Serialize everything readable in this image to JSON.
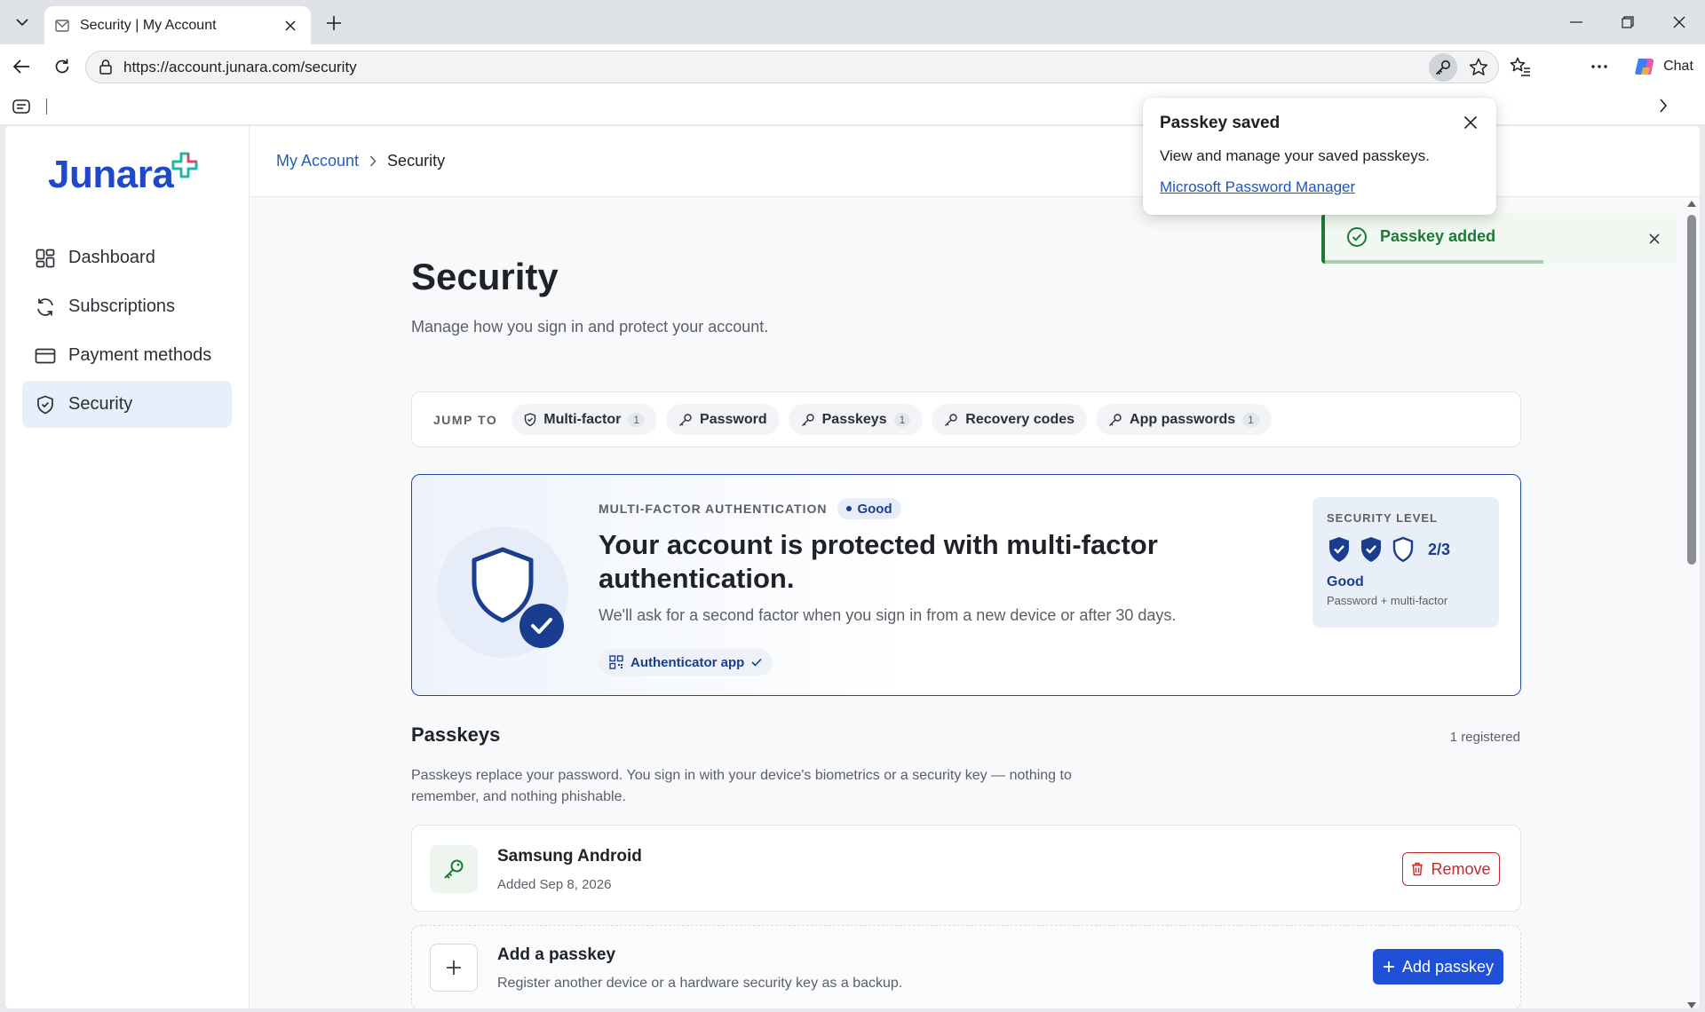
{
  "browser": {
    "tab_title": "Security | My Account",
    "url_host": "https://account.junara.com",
    "url_path": "/security",
    "chat_label": "Chat"
  },
  "popup": {
    "title": "Passkey saved",
    "description": "View and manage your saved passkeys.",
    "link": "Microsoft Password Manager"
  },
  "toast": {
    "message": "Passkey added",
    "progress": 0.62
  },
  "sidebar": {
    "logo": "Junara",
    "items": [
      {
        "label": "Dashboard",
        "icon": "dashboard-icon",
        "active": false
      },
      {
        "label": "Subscriptions",
        "icon": "refresh-icon",
        "active": false
      },
      {
        "label": "Payment methods",
        "icon": "card-icon",
        "active": false
      },
      {
        "label": "Security",
        "icon": "shield-icon",
        "active": true
      }
    ]
  },
  "breadcrumb": {
    "parent": "My Account",
    "current": "Security"
  },
  "page": {
    "title": "Security",
    "subtitle": "Manage how you sign in and protect your account."
  },
  "jump": {
    "label": "JUMP TO",
    "chips": [
      {
        "label": "Multi-factor",
        "count": "1",
        "icon": "shield-icon"
      },
      {
        "label": "Password",
        "count": "",
        "icon": "key-icon"
      },
      {
        "label": "Passkeys",
        "count": "1",
        "icon": "key-icon"
      },
      {
        "label": "Recovery codes",
        "count": "",
        "icon": "key-icon"
      },
      {
        "label": "App passwords",
        "count": "1",
        "icon": "key-icon"
      }
    ]
  },
  "mfa": {
    "eyebrow": "MULTI-FACTOR AUTHENTICATION",
    "status": "Good",
    "title": "Your account is protected with multi-factor authentication.",
    "description": "We'll ask for a second factor when you sign in from a new device or after 30 days.",
    "method": "Authenticator app",
    "level": {
      "label": "SECURITY LEVEL",
      "value": "2/3",
      "filled": 2,
      "total": 3,
      "rating": "Good",
      "detail": "Password + multi-factor"
    }
  },
  "passkeys": {
    "title": "Passkeys",
    "count": "1 registered",
    "description": "Passkeys replace your password. You sign in with your device's biometrics or a security key — nothing to remember, and nothing phishable.",
    "items": [
      {
        "name": "Samsung Android",
        "added": "Added Sep 8, 2026",
        "remove_label": "Remove"
      }
    ],
    "add": {
      "title": "Add a passkey",
      "description": "Register another device or a hardware security key as a backup.",
      "button": "Add passkey"
    }
  },
  "colors": {
    "brand": "#1f49c8",
    "primary_button": "#1f4fd6",
    "danger": "#c62828",
    "success": "#1e7a34",
    "shield": "#1a3d8f"
  }
}
